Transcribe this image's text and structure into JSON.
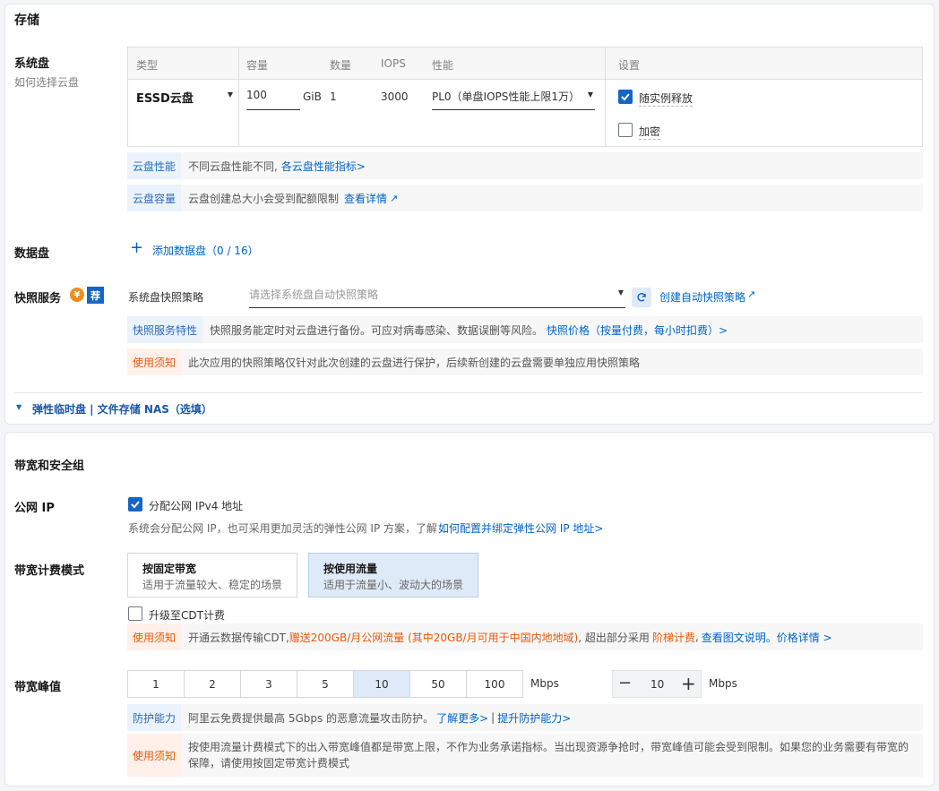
{
  "storage": {
    "section_title": "存储",
    "system_disk": {
      "label": "系统盘",
      "help_link": "如何选择云盘",
      "columns": [
        "类型",
        "容量",
        "数量",
        "IOPS",
        "性能",
        "设置"
      ],
      "type_value": "ESSD云盘",
      "capacity_value": "100",
      "capacity_unit": "GiB",
      "count_value": "1",
      "iops_value": "3000",
      "performance_value": "PL0（单盘IOPS性能上限1万）",
      "release_with_instance": {
        "label": "随实例释放",
        "checked": true
      },
      "encrypt": {
        "label": "加密",
        "checked": false
      }
    },
    "disk_performance_hint": {
      "tag": "云盘性能",
      "text": "不同云盘性能不同,",
      "link": "各云盘性能指标>"
    },
    "disk_capacity_hint": {
      "tag": "云盘容量",
      "text": "云盘创建总大小会受到配额限制",
      "link": "查看详情"
    },
    "data_disk": {
      "label": "数据盘",
      "add_label": "添加数据盘（0 / 16）"
    },
    "snapshot": {
      "label": "快照服务",
      "badge_yen": "¥",
      "badge_rec": "荐",
      "policy_label": "系统盘快照策略",
      "policy_placeholder": "请选择系统盘自动快照策略",
      "create_link": "创建自动快照策略",
      "feature_hint": {
        "tag": "快照服务特性",
        "text": "快照服务能定时对云盘进行备份。可应对病毒感染、数据误删等风险。",
        "link": "快照价格（按量付费，每小时扣费）>"
      },
      "notice_hint": {
        "tag": "使用须知",
        "text": "此次应用的快照策略仅针对此次创建的云盘进行保护，后续新创建的云盘需要单独应用快照策略"
      }
    },
    "elastic_toggle": "弹性临时盘 | 文件存储 NAS（选填）"
  },
  "network": {
    "section_title": "带宽和安全组",
    "public_ip": {
      "label": "公网 IP",
      "assign_label": "分配公网 IPv4 地址",
      "checked": true,
      "desc": "系统会分配公网 IP，也可采用更加灵活的弹性公网 IP 方案，了解",
      "desc_link": "如何配置并绑定弹性公网 IP 地址>"
    },
    "billing": {
      "label": "带宽计费模式",
      "options": [
        {
          "title": "按固定带宽",
          "desc": "适用于流量较大、稳定的场景",
          "selected": false
        },
        {
          "title": "按使用流量",
          "desc": "适用于流量小、波动大的场景",
          "selected": true
        }
      ],
      "cdt_label": "升级至CDT计费",
      "cdt_checked": false,
      "notice": {
        "tag": "使用须知",
        "text1": "开通云数据传输CDT,",
        "text_orange1": "赠送200GB/月公网流量 (其中20GB/月可用于中国内地地域)",
        "text2": ", 超出部分采用",
        "text_orange2": "阶梯计费",
        "text3": ",",
        "link1": "查看图文说明。",
        "link2": "价格详情 >"
      }
    },
    "peak": {
      "label": "带宽峰值",
      "options": [
        "1",
        "2",
        "3",
        "5",
        "10",
        "50",
        "100"
      ],
      "selected": "10",
      "unit": "Mbps",
      "stepper_value": "10",
      "stepper_unit": "Mbps",
      "protect_hint": {
        "tag": "防护能力",
        "text": "阿里云免费提供最高 5Gbps 的恶意流量攻击防护。",
        "link1": "了解更多>",
        "sep": "|",
        "link2": "提升防护能力>"
      },
      "notice_hint": {
        "tag": "使用须知",
        "line1": "按使用流量计费模式下的出入带宽峰值都是带宽上限，不作为业务承诺指标。当出现资源争抢时，带宽峰值可能会受到限制。如果您的业务需要有带宽的",
        "line2": "保障，请使用按固定带宽计费模式"
      }
    }
  },
  "colors": {
    "primary": "#1665c6",
    "link": "#0064c8",
    "warn": "#e8590c",
    "hint_bg": "#f7f7f7"
  }
}
